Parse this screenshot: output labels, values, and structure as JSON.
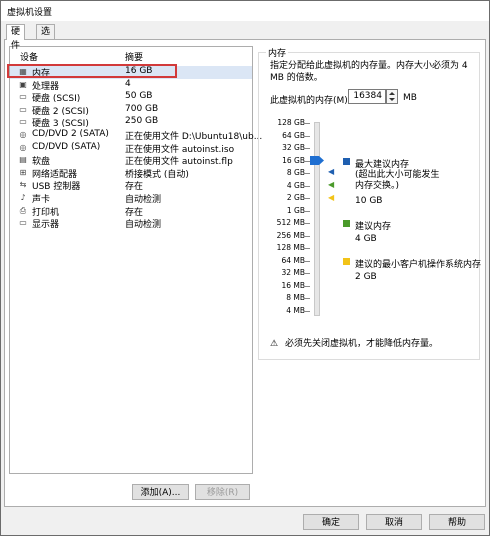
{
  "window": {
    "title": "虚拟机设置"
  },
  "tabs": [
    {
      "label": "硬件",
      "active": true
    },
    {
      "label": "选项",
      "active": false
    }
  ],
  "list": {
    "headers": {
      "device": "设备",
      "summary": "摘要"
    },
    "rows": [
      {
        "icon": "memory-icon",
        "device": "内存",
        "summary": "16 GB",
        "selected": true
      },
      {
        "icon": "processor-icon",
        "device": "处理器",
        "summary": "4"
      },
      {
        "icon": "harddisk-icon",
        "device": "硬盘 (SCSI)",
        "summary": "50 GB"
      },
      {
        "icon": "harddisk-icon",
        "device": "硬盘 2 (SCSI)",
        "summary": "700 GB"
      },
      {
        "icon": "harddisk-icon",
        "device": "硬盘 3 (SCSI)",
        "summary": "250 GB"
      },
      {
        "icon": "cd-icon",
        "device": "CD/DVD 2 (SATA)",
        "summary": "正在使用文件 D:\\Ubuntu18\\ub..."
      },
      {
        "icon": "cd-icon",
        "device": "CD/DVD (SATA)",
        "summary": "正在使用文件 autoinst.iso"
      },
      {
        "icon": "floppy-icon",
        "device": "软盘",
        "summary": "正在使用文件 autoinst.flp"
      },
      {
        "icon": "network-icon",
        "device": "网络适配器",
        "summary": "桥接模式 (自动)"
      },
      {
        "icon": "usb-icon",
        "device": "USB 控制器",
        "summary": "存在"
      },
      {
        "icon": "sound-icon",
        "device": "声卡",
        "summary": "自动检测"
      },
      {
        "icon": "printer-icon",
        "device": "打印机",
        "summary": "存在"
      },
      {
        "icon": "display-icon",
        "device": "显示器",
        "summary": "自动检测"
      }
    ],
    "add_button": "添加(A)...",
    "remove_button": "移除(R)"
  },
  "memory": {
    "group_title": "内存",
    "description": "指定分配给此虚拟机的内存量。内存大小必须为 4 MB 的倍数。",
    "label": "此虚拟机的内存(M):",
    "value": "16384",
    "unit": "MB",
    "scale": [
      "128 GB",
      "64 GB",
      "32 GB",
      "16 GB",
      "8 GB",
      "4 GB",
      "2 GB",
      "1 GB",
      "512 MB",
      "256 MB",
      "128 MB",
      "64 MB",
      "32 MB",
      "16 MB",
      "8 MB",
      "4 MB"
    ],
    "current_step_index": 3,
    "legend": {
      "max_title": "最大建议内存",
      "max_note": "(超出此大小可能发生内存交换。)",
      "max_value": "10 GB",
      "rec_title": "建议内存",
      "rec_value": "4 GB",
      "min_title": "建议的最小客户机操作系统内存",
      "min_value": "2 GB",
      "colors": {
        "max": "#1f5fb0",
        "rec": "#4a9a2a",
        "min": "#f2c318"
      }
    },
    "warning": "必须先关闭虚拟机，才能降低内存量。"
  },
  "footer": {
    "ok": "确定",
    "cancel": "取消",
    "help": "帮助"
  }
}
